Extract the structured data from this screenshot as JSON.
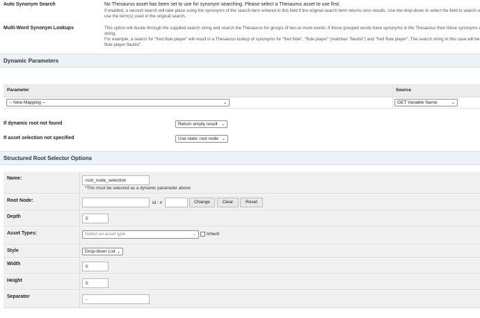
{
  "top": {
    "auto_synonym": {
      "label": "Auto Synonym Search",
      "note": "No Thesaurus asset has been set to use for synonym searching. Please select a Thesaurus asset to use first.",
      "help1": "If enabled, a second search will take place using the synonyms of the search term entered in this field if the original search term returns zero results. Use the drop-down to select the field to search with. All other sea",
      "help2": "use the term(s) used in the original search."
    },
    "multiword": {
      "label": "Multi-Word Synonym Lookups",
      "help1": "This option will iterate through the supplied search string and search the Thesaurus for groups of two-or-more words. If these grouped words have synonyms in the Thesaurus then these synonyms will be appended",
      "help2": "string.",
      "help3": "For example, a search for \"fred flute player\" will result in a Thesaurus lookup of synonyms for \"fred flute\", \"flute player\" (matches \"flautist\") and \"fred flute player\". The search string in this case will be modified on-the",
      "help4": "flute player flautist\"."
    }
  },
  "dynamic": {
    "title": "Dynamic Parameters",
    "col_parameter": "Parameter",
    "col_source": "Source",
    "mapping_value": "-- New Mapping --",
    "source_value": "GET Variable Name",
    "root_not_found_label": "If dynamic root not found",
    "root_not_found_value": "Return empty result",
    "asset_not_specified_label": "If asset selection not specified",
    "asset_not_specified_value": "Use static root node"
  },
  "structured": {
    "title": "Structured Root Selector Options",
    "name_label": "Name:",
    "name_value": "root_node_selection",
    "name_note": "*This must be selected as a dynamic parameter above",
    "root_label": "Root Node:",
    "id_label": "id : #",
    "change_btn": "Change",
    "clear_btn": "Clear",
    "reset_btn": "Reset",
    "depth_label": "Depth",
    "depth_value": "0",
    "asset_types_label": "Asset Types:",
    "asset_types_placeholder": "Select an asset type",
    "inherit_label": "Inherit",
    "style_label": "Style",
    "style_value": "Drop-down List",
    "width_label": "Width",
    "width_value": "0",
    "height_label": "Height",
    "height_value": "0",
    "separator_label": "Separator",
    "separator_value": "-"
  }
}
